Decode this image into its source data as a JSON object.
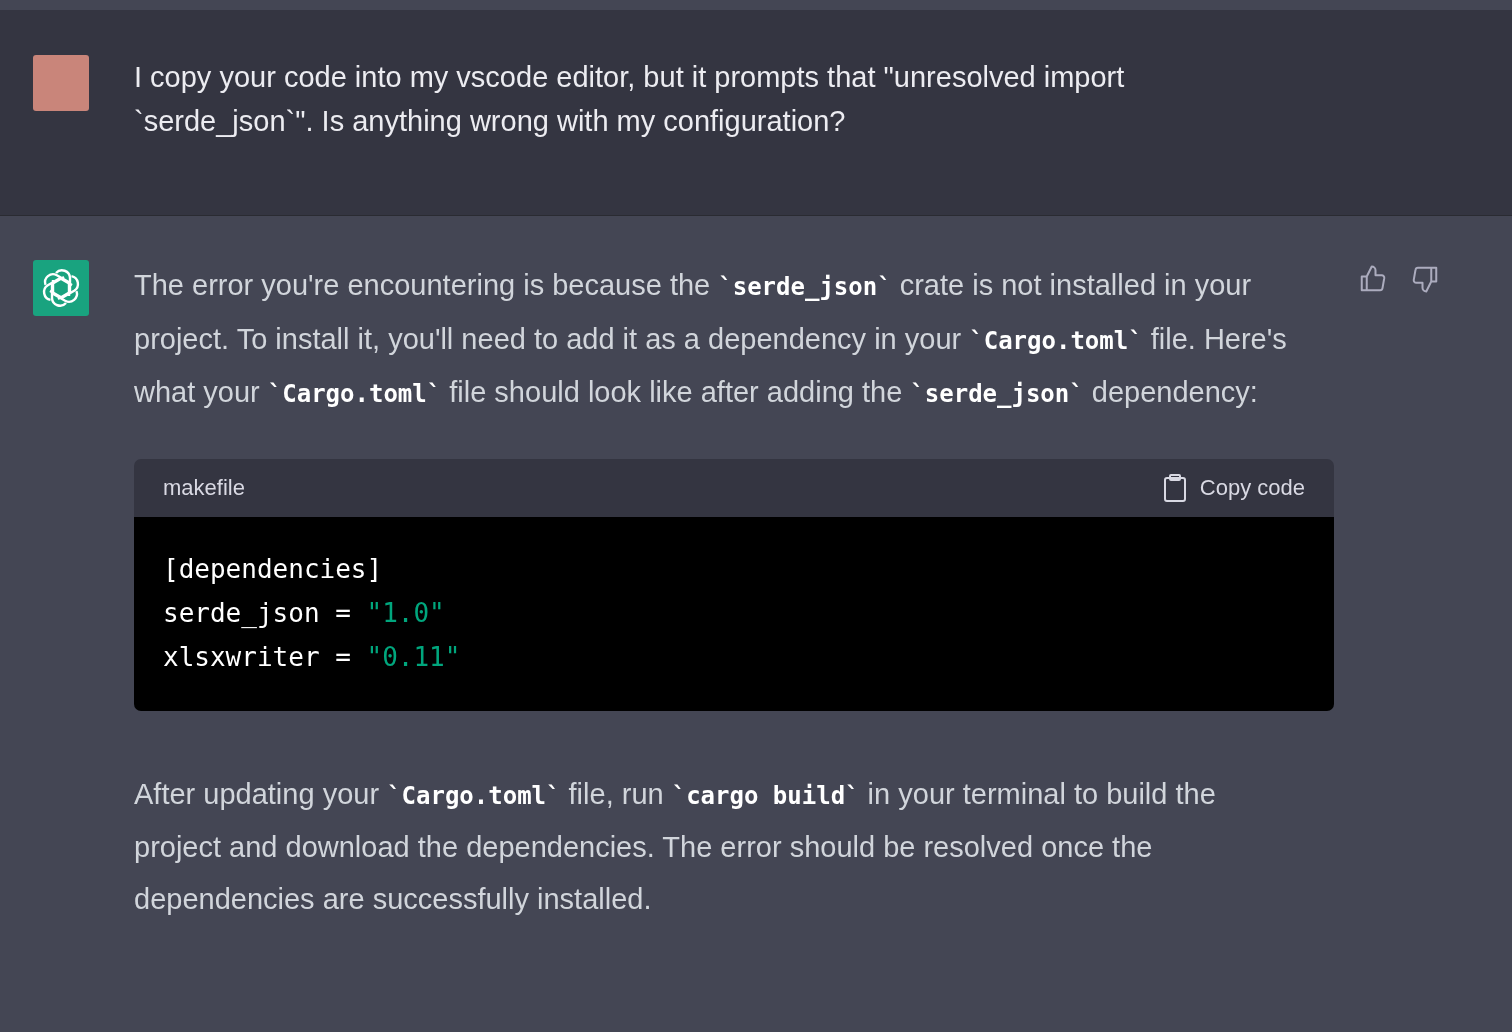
{
  "messages": [
    {
      "kind": "user",
      "text": "I copy your code into my vscode editor, but it prompts that \"unresolved import `serde_json`\". Is anything wrong with my configuration?"
    },
    {
      "kind": "assistant",
      "blocks": [
        {
          "kind": "paragraph",
          "text": "The error you're encountering is because the **`serde_json`** crate is not installed in your project. To install it, you'll need to add it as a dependency in your **`Cargo.toml`** file. Here's what your **`Cargo.toml`** file should look like after adding the **`serde_json`** dependency:"
        },
        {
          "kind": "code",
          "language": "makefile",
          "copy_label": "Copy code",
          "lines": [
            [
              {
                "kind": "plain",
                "text": "[dependencies]"
              }
            ],
            [
              {
                "kind": "plain",
                "text": "serde_json = "
              },
              {
                "kind": "string",
                "text": "\"1.0\""
              }
            ],
            [
              {
                "kind": "plain",
                "text": "xlsxwriter = "
              },
              {
                "kind": "string",
                "text": "\"0.11\""
              }
            ]
          ]
        },
        {
          "kind": "paragraph",
          "text": "After updating your **`Cargo.toml`** file, run **`cargo build`** in your terminal to build the project and download the dependencies. The error should be resolved once the dependencies are successfully installed."
        }
      ]
    }
  ]
}
